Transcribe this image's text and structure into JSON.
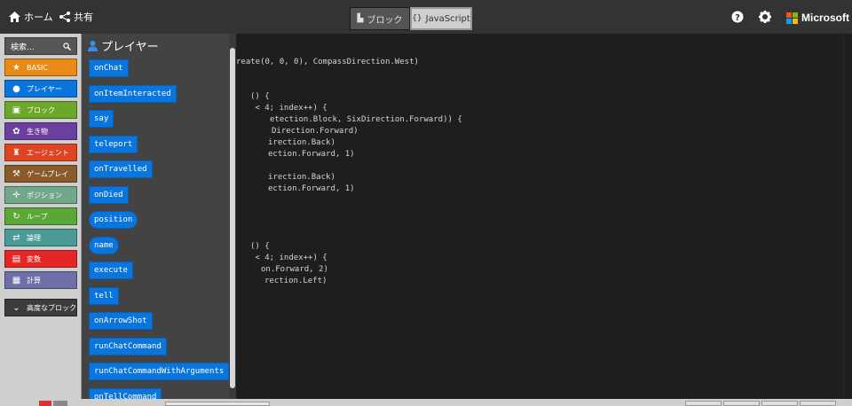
{
  "topbar": {
    "home_label": "ホーム",
    "share_label": "共有",
    "blocks_label": "ブロック",
    "js_label": "JavaScript",
    "brand": "Microsoft"
  },
  "toolbox": {
    "search_placeholder": "検索...",
    "categories": [
      {
        "label": "BASIC",
        "color": "#e98a17",
        "icon": "star-icon"
      },
      {
        "label": "プレイヤー",
        "color": "#0a75dc",
        "icon": "person-icon"
      },
      {
        "label": "ブロック",
        "color": "#6ca62b",
        "icon": "cube-icon"
      },
      {
        "label": "生き物",
        "color": "#6b3fa0",
        "icon": "paw-icon"
      },
      {
        "label": "エージェント",
        "color": "#dd4423",
        "icon": "agent-icon"
      },
      {
        "label": "ゲームプレイ",
        "color": "#8b5a2b",
        "icon": "hammer-icon"
      },
      {
        "label": "ポジション",
        "color": "#71a88a",
        "icon": "crosshair-icon"
      },
      {
        "label": "ループ",
        "color": "#5aa637",
        "icon": "loop-icon"
      },
      {
        "label": "論理",
        "color": "#4a9b96",
        "icon": "shuffle-icon"
      },
      {
        "label": "変数",
        "color": "#e32727",
        "icon": "table-icon"
      },
      {
        "label": "計算",
        "color": "#6f6fa8",
        "icon": "calculator-icon"
      }
    ],
    "advanced_label": "高度なブロック"
  },
  "flyout": {
    "title": "プレイヤー",
    "blocks": [
      {
        "label": "onChat",
        "shape": "rect"
      },
      {
        "label": "onItemInteracted",
        "shape": "rect"
      },
      {
        "label": "say",
        "shape": "rect"
      },
      {
        "label": "teleport",
        "shape": "rect"
      },
      {
        "label": "onTravelled",
        "shape": "rect"
      },
      {
        "label": "onDied",
        "shape": "rect"
      },
      {
        "label": "position",
        "shape": "round"
      },
      {
        "label": "name",
        "shape": "round"
      },
      {
        "label": "execute",
        "shape": "rect"
      },
      {
        "label": "tell",
        "shape": "rect"
      },
      {
        "label": "onArrowShot",
        "shape": "rect"
      },
      {
        "label": "runChatCommand",
        "shape": "rect"
      },
      {
        "label": "runChatCommandWithArguments",
        "shape": "rect"
      },
      {
        "label": "onTellCommand",
        "shape": "rect"
      }
    ]
  },
  "editor": {
    "lines": [
      {
        "hidden": "                ",
        "visible": ""
      },
      {
        "hidden": "",
        "visible": "reate(0, 0, 0), CompassDirection.West)"
      },
      {
        "hidden": "",
        "visible": ""
      },
      {
        "hidden": "",
        "visible": ""
      },
      {
        "hidden": "",
        "visible": "() {"
      },
      {
        "hidden": "",
        "visible": " < 4; index++) {"
      },
      {
        "hidden": "",
        "visible": "etection.Block, SixDirection.Forward)) {"
      },
      {
        "hidden": "",
        "visible": "Direction.Forward)"
      },
      {
        "hidden": "",
        "visible": "irection.Back)"
      },
      {
        "hidden": "",
        "visible": "ection.Forward, 1)"
      },
      {
        "hidden": "",
        "visible": ""
      },
      {
        "hidden": "",
        "visible": "irection.Back)"
      },
      {
        "hidden": "",
        "visible": "ection.Forward, 1)"
      },
      {
        "hidden": "",
        "visible": ""
      },
      {
        "hidden": "",
        "visible": ""
      },
      {
        "hidden": "",
        "visible": ""
      },
      {
        "hidden": "",
        "visible": ""
      },
      {
        "hidden": "",
        "visible": "() {"
      },
      {
        "hidden": "",
        "visible": " < 4; index++) {"
      },
      {
        "hidden": "",
        "visible": "on.Forward, 2)"
      },
      {
        "hidden": "",
        "visible": "rection.Left)"
      }
    ]
  }
}
